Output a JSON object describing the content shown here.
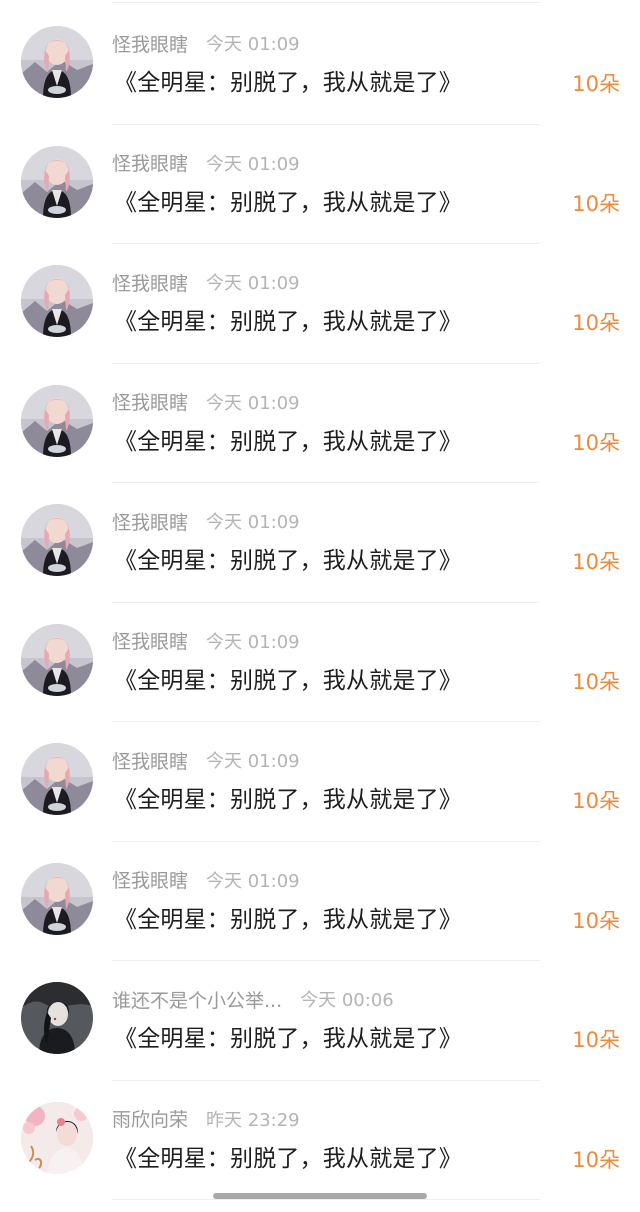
{
  "gift_list": [
    {
      "avatar": "avatar-girl-pink-hair",
      "user": "怪我眼瞎",
      "time": "今天 01:09",
      "title": "《全明星：别脱了，我从就是了》",
      "count": "10朵"
    },
    {
      "avatar": "avatar-girl-pink-hair",
      "user": "怪我眼瞎",
      "time": "今天 01:09",
      "title": "《全明星：别脱了，我从就是了》",
      "count": "10朵"
    },
    {
      "avatar": "avatar-girl-pink-hair",
      "user": "怪我眼瞎",
      "time": "今天 01:09",
      "title": "《全明星：别脱了，我从就是了》",
      "count": "10朵"
    },
    {
      "avatar": "avatar-girl-pink-hair",
      "user": "怪我眼瞎",
      "time": "今天 01:09",
      "title": "《全明星：别脱了，我从就是了》",
      "count": "10朵"
    },
    {
      "avatar": "avatar-girl-pink-hair",
      "user": "怪我眼瞎",
      "time": "今天 01:09",
      "title": "《全明星：别脱了，我从就是了》",
      "count": "10朵"
    },
    {
      "avatar": "avatar-girl-pink-hair",
      "user": "怪我眼瞎",
      "time": "今天 01:09",
      "title": "《全明星：别脱了，我从就是了》",
      "count": "10朵"
    },
    {
      "avatar": "avatar-girl-pink-hair",
      "user": "怪我眼瞎",
      "time": "今天 01:09",
      "title": "《全明星：别脱了，我从就是了》",
      "count": "10朵"
    },
    {
      "avatar": "avatar-girl-pink-hair",
      "user": "怪我眼瞎",
      "time": "今天 01:09",
      "title": "《全明星：别脱了，我从就是了》",
      "count": "10朵"
    },
    {
      "avatar": "avatar-dark-ink-girl",
      "user": "谁还不是个小公举...",
      "time": "今天 00:06",
      "title": "《全明星：别脱了，我从就是了》",
      "count": "10朵"
    },
    {
      "avatar": "avatar-pink-flower-girl",
      "user": "雨欣向荣",
      "time": "昨天 23:29",
      "title": "《全明星：别脱了，我从就是了》",
      "count": "10朵"
    }
  ],
  "colors": {
    "count_accent": "#ee8a3c",
    "username": "#9a9a9a",
    "timestamp": "#b4b4b4",
    "title_text": "#1e1e1e"
  }
}
